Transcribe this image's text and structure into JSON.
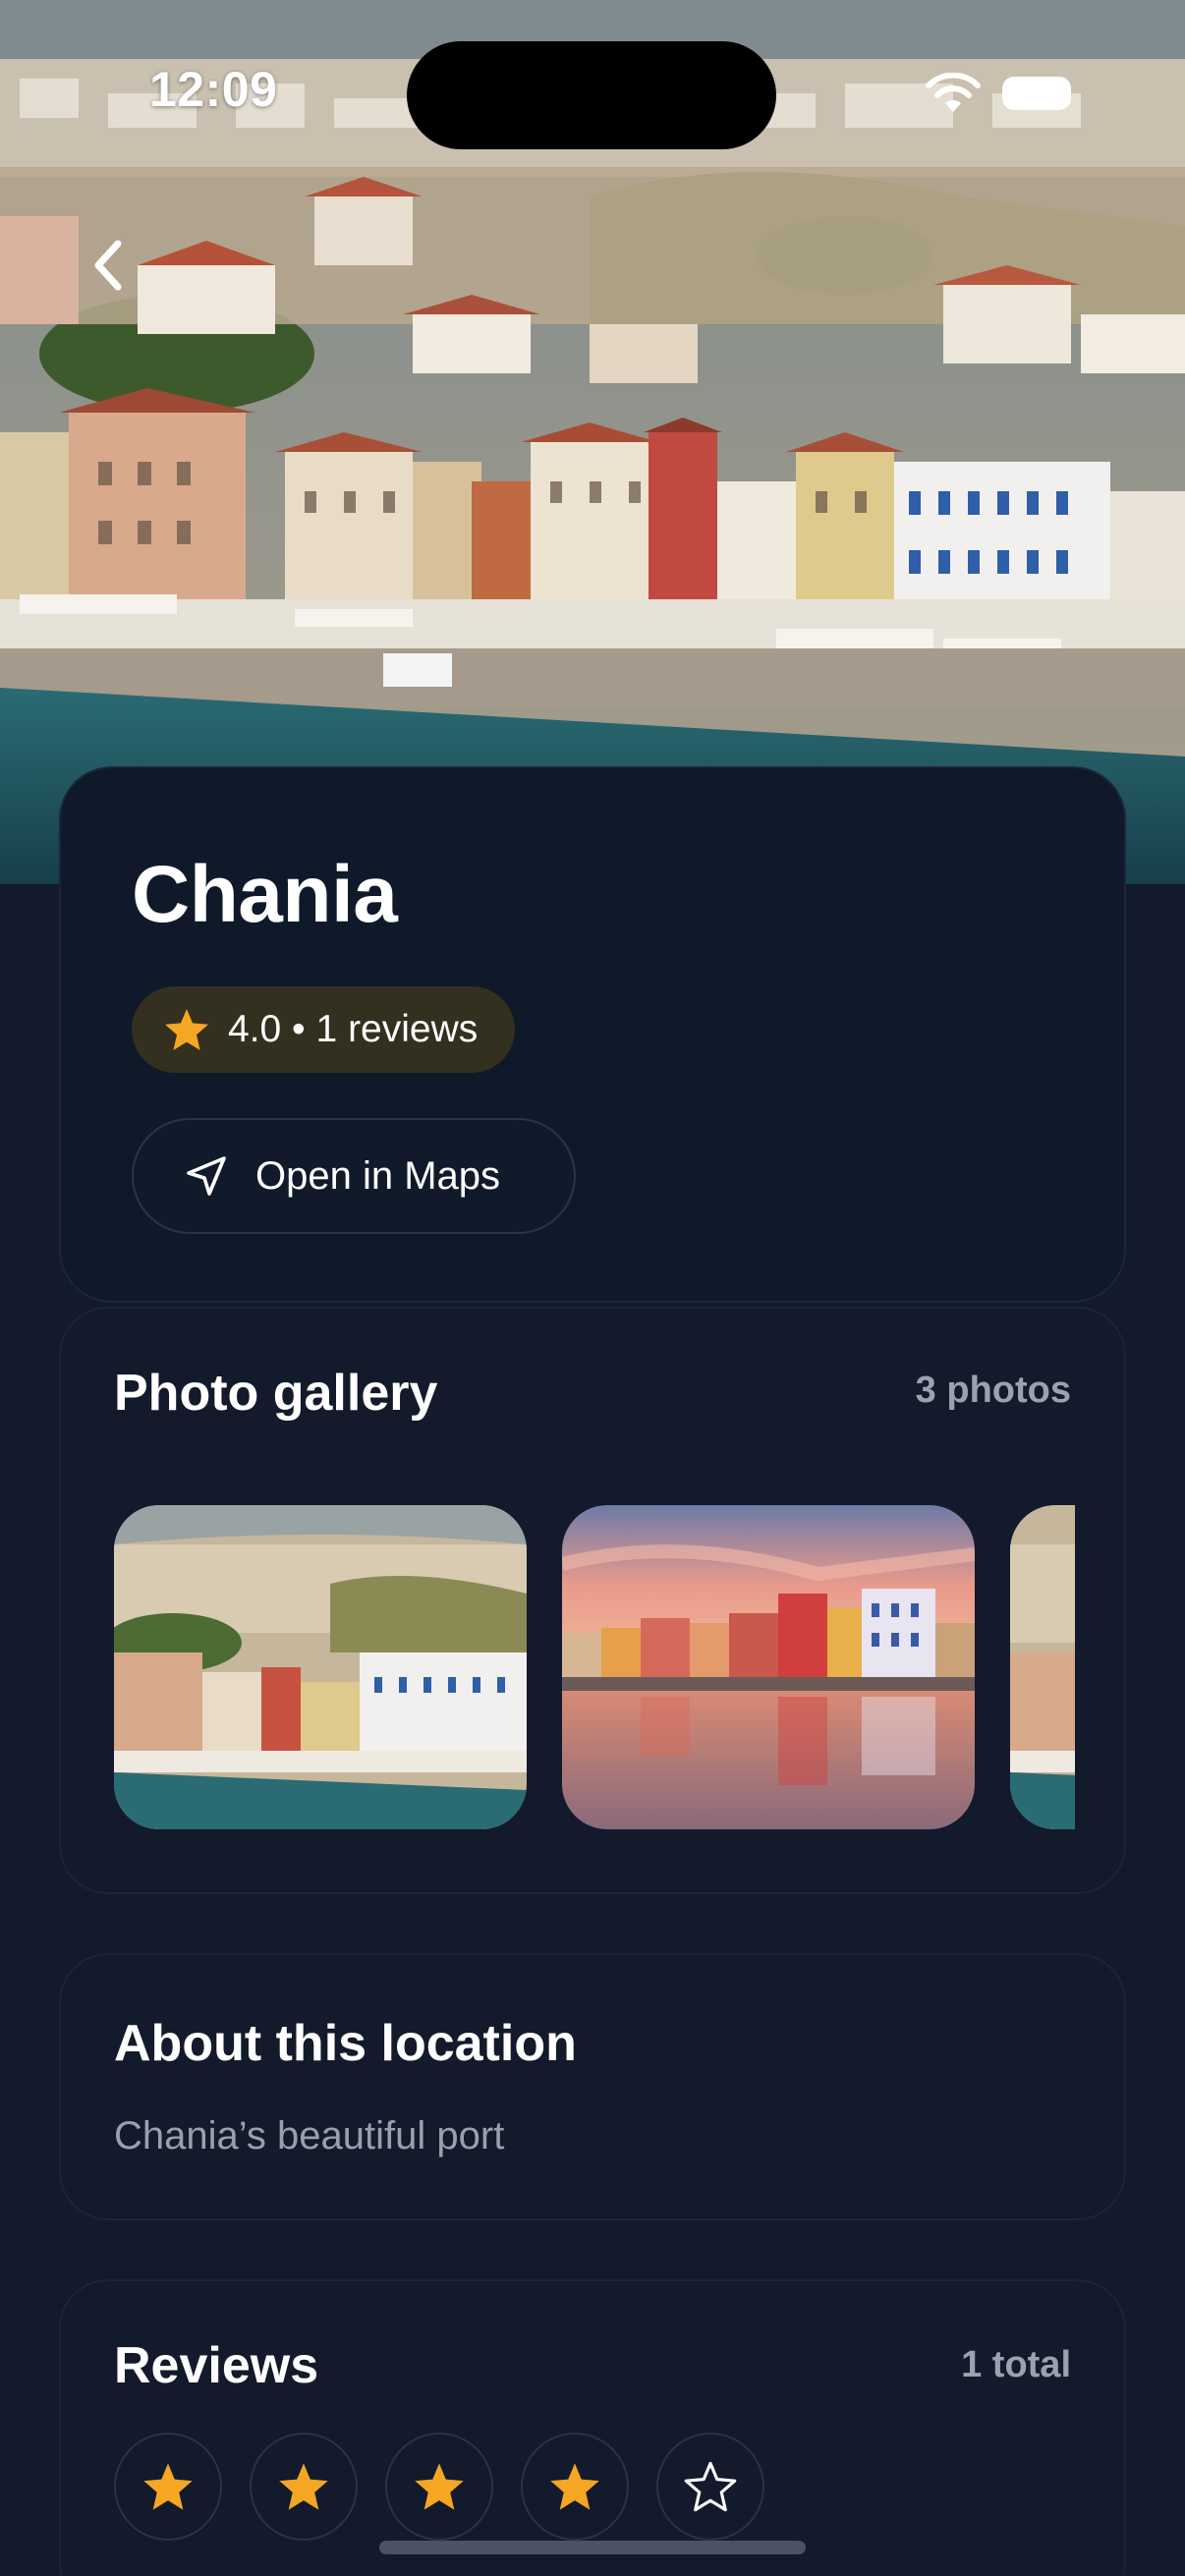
{
  "status_bar": {
    "time": "12:09"
  },
  "place": {
    "name": "Chania",
    "rating_text": "4.0 • 1 reviews",
    "open_maps_label": "Open in Maps"
  },
  "gallery": {
    "title": "Photo gallery",
    "count_label": "3 photos"
  },
  "about": {
    "title": "About this location",
    "description": "Chania’s beautiful port"
  },
  "reviews": {
    "title": "Reviews",
    "total_label": "1 total",
    "selected_stars": 4,
    "max_stars": 5
  },
  "colors": {
    "background": "#121a2b",
    "card": "#101929",
    "star": "#f5a623",
    "rating_pill": "#33301f",
    "muted_text": "#9aa0ab"
  },
  "icons": {
    "back": "chevron-left-icon",
    "rating": "star-icon",
    "maps": "navigation-arrow-icon",
    "wifi": "wifi-icon",
    "battery": "battery-icon"
  }
}
